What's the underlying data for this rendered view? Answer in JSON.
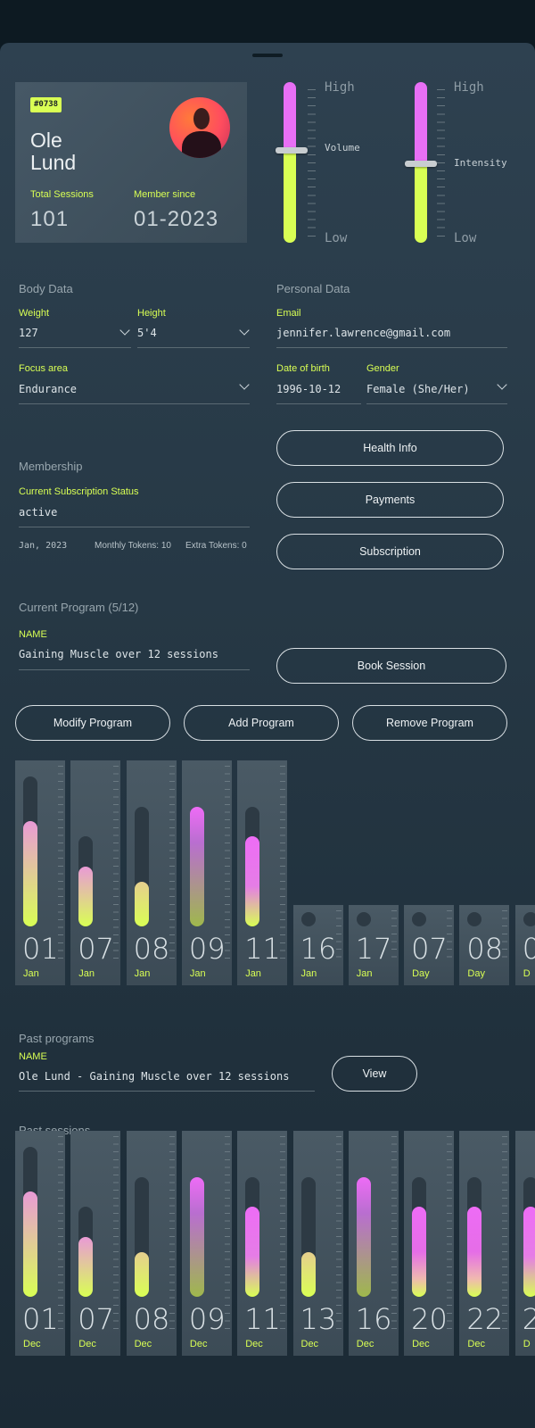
{
  "profile": {
    "id_badge": "#0738",
    "first_name": "Ole",
    "last_name": "Lund",
    "total_sessions_label": "Total Sessions",
    "total_sessions": "101",
    "member_since_label": "Member since",
    "member_since": "01-2023"
  },
  "sliders": [
    {
      "high": "High",
      "low": "Low",
      "label": "Volume",
      "level": 0.58
    },
    {
      "high": "High",
      "low": "Low",
      "label": "Intensity",
      "level": 0.49
    }
  ],
  "body_data": {
    "title": "Body Data",
    "weight_label": "Weight",
    "weight": "127",
    "height_label": "Height",
    "height": "5'4",
    "focus_label": "Focus area",
    "focus": "Endurance"
  },
  "personal_data": {
    "title": "Personal Data",
    "email_label": "Email",
    "email": "jennifer.lawrence@gmail.com",
    "dob_label": "Date of birth",
    "dob": "1996-10-12",
    "gender_label": "Gender",
    "gender": "Female (She/Her)"
  },
  "membership": {
    "title": "Membership",
    "status_label": "Current Subscription Status",
    "status": "active",
    "date": "Jan, 2023",
    "monthly_tokens": "Monthly Tokens: 10",
    "extra_tokens": "Extra Tokens: 0"
  },
  "actions": {
    "health_info": "Health Info",
    "payments": "Payments",
    "subscription": "Subscription",
    "book_session": "Book Session",
    "modify_program": "Modify Program",
    "add_program": "Add Program",
    "remove_program": "Remove Program",
    "view": "View"
  },
  "current_program": {
    "title": "Current Program (5/12)",
    "name_label": "NAME",
    "name": "Gaining Muscle over 12 sessions"
  },
  "program_sessions": [
    {
      "day": "01",
      "month": "Jan",
      "level": 0.7,
      "track": 1.0,
      "color": "pink-lime",
      "done": true
    },
    {
      "day": "07",
      "month": "Jan",
      "level": 0.4,
      "track": 0.6,
      "color": "pink-lime",
      "done": true
    },
    {
      "day": "08",
      "month": "Jan",
      "level": 0.3,
      "track": 0.8,
      "color": "tan-lime",
      "done": true
    },
    {
      "day": "09",
      "month": "Jan",
      "level": 0.8,
      "track": 0.8,
      "color": "magenta-olive",
      "done": true
    },
    {
      "day": "11",
      "month": "Jan",
      "level": 0.6,
      "track": 0.8,
      "color": "magenta-lime",
      "done": true
    },
    {
      "day": "16",
      "month": "Jan",
      "done": false
    },
    {
      "day": "17",
      "month": "Jan",
      "done": false
    },
    {
      "day": "07",
      "month": "Day",
      "done": false
    },
    {
      "day": "08",
      "month": "Day",
      "done": false
    },
    {
      "day": "0",
      "month": "D",
      "done": false
    }
  ],
  "past_programs": {
    "title": "Past programs",
    "name_label": "NAME",
    "name": "Ole Lund - Gaining Muscle over 12 sessions"
  },
  "past_sessions_title": "Past sessions",
  "past_sessions": [
    {
      "day": "01",
      "month": "Dec",
      "level": 0.7,
      "track": 1.0,
      "color": "pink-lime"
    },
    {
      "day": "07",
      "month": "Dec",
      "level": 0.4,
      "track": 0.6,
      "color": "pink-lime"
    },
    {
      "day": "08",
      "month": "Dec",
      "level": 0.3,
      "track": 0.8,
      "color": "tan-lime"
    },
    {
      "day": "09",
      "month": "Dec",
      "level": 0.8,
      "track": 0.8,
      "color": "magenta-olive"
    },
    {
      "day": "11",
      "month": "Dec",
      "level": 0.6,
      "track": 0.8,
      "color": "magenta-lime"
    },
    {
      "day": "13",
      "month": "Dec",
      "level": 0.3,
      "track": 0.8,
      "color": "tan-lime"
    },
    {
      "day": "16",
      "month": "Dec",
      "level": 0.8,
      "track": 0.8,
      "color": "magenta-olive"
    },
    {
      "day": "20",
      "month": "Dec",
      "level": 0.6,
      "track": 0.8,
      "color": "magenta-pink"
    },
    {
      "day": "22",
      "month": "Dec",
      "level": 0.6,
      "track": 0.8,
      "color": "magenta-pink"
    },
    {
      "day": "2",
      "month": "D",
      "level": 0.6,
      "track": 0.8,
      "color": "magenta-lime"
    }
  ],
  "colors": {
    "accent_lime": "#d9ff54",
    "accent_magenta": "#e86ff5",
    "background": "#263845"
  }
}
